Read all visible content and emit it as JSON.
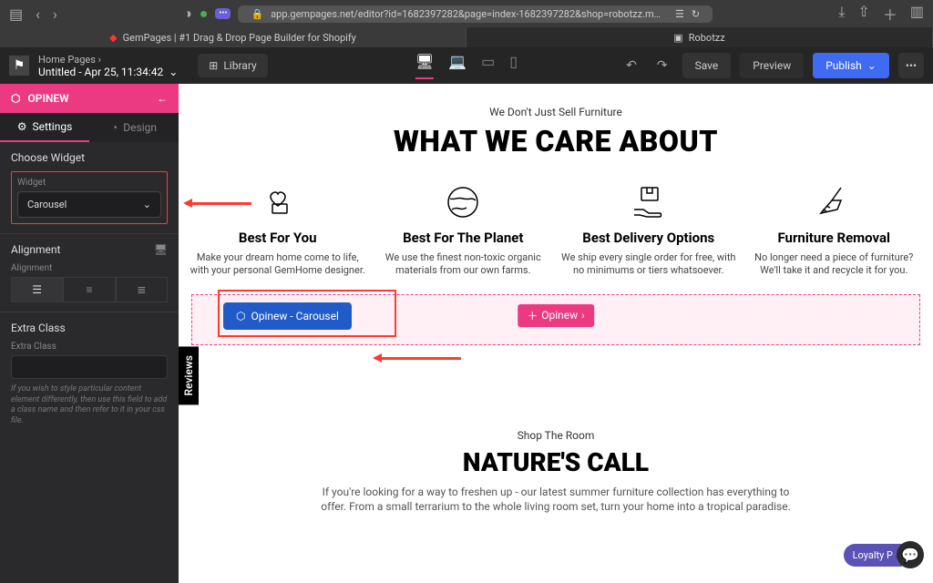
{
  "browser": {
    "url": "app.gempages.net/editor?id=1682397282&page=index-1682397282&shop=robotzz.m…",
    "tab1": "GemPages | #1 Drag & Drop Page Builder for Shopify",
    "tab2": "Robotzz"
  },
  "topbar": {
    "breadcrumb": "Home Pages",
    "title": "Untitled - Apr 25, 11:34:42",
    "library": "Library",
    "save": "Save",
    "preview": "Preview",
    "publish": "Publish"
  },
  "sidebar": {
    "header": "OPINEW",
    "tabs": {
      "settings": "Settings",
      "design": "Design"
    },
    "choose_widget": {
      "title": "Choose Widget",
      "label": "Widget",
      "value": "Carousel"
    },
    "alignment": {
      "title": "Alignment",
      "label": "Alignment"
    },
    "extra_class": {
      "title": "Extra Class",
      "label": "Extra Class",
      "hint": "If you wish to style particular content element differently, then use this field to add a class name and then refer to it in your css file."
    }
  },
  "reviews_label": "Reviews",
  "canvas": {
    "s1_sub": "We Don't Just Sell Furniture",
    "s1_h1": "WHAT WE CARE ABOUT",
    "features": [
      {
        "icon": "🤝",
        "title": "Best For You",
        "desc": "Make your dream home come to life, with your personal GemHome designer."
      },
      {
        "icon": "🌍",
        "title": "Best For The Planet",
        "desc": "We use the finest non-toxic organic materials from our own farms."
      },
      {
        "icon": "📦",
        "title": "Best Delivery Options",
        "desc": "We ship every single order for free, with no minimums or tiers whatsoever."
      },
      {
        "icon": "🧹",
        "title": "Furniture Removal",
        "desc": "No longer need a piece of furniture? We'll take it and recycle it for you."
      }
    ],
    "opinew_badge": "Opinew - Carousel",
    "opinew_pink": "Opinew",
    "s2_sub": "Shop The Room",
    "s2_h2": "NATURE'S CALL",
    "s2_para": "If you're looking for a way to freshen up - our latest summer furniture collection has everything to offer. From a small terrarium to the whole living room set, turn your home into a tropical paradise."
  },
  "loyalty": "Loyalty P"
}
